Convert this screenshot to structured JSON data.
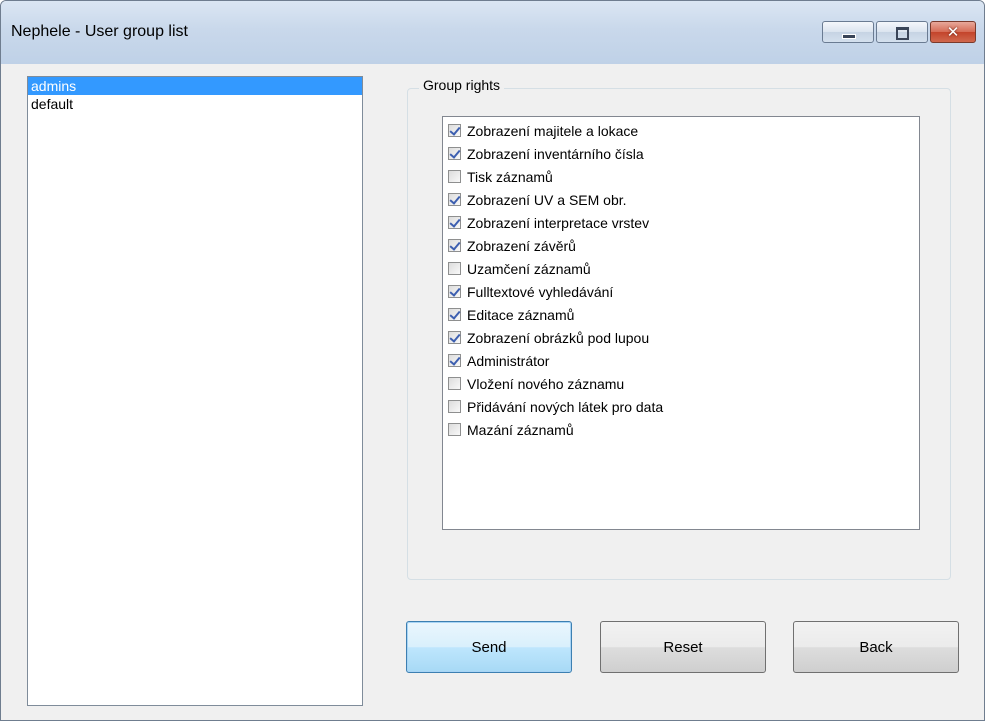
{
  "window": {
    "title": "Nephele - User group list",
    "minimize_label": "",
    "close_glyph": "✕"
  },
  "groups": [
    {
      "label": "admins",
      "selected": true
    },
    {
      "label": "default",
      "selected": false
    }
  ],
  "rights": {
    "legend": "Group rights",
    "items": [
      {
        "label": "Zobrazení majitele a lokace",
        "checked": true
      },
      {
        "label": "Zobrazení inventárního čísla",
        "checked": true
      },
      {
        "label": "Tisk záznamů",
        "checked": false
      },
      {
        "label": "Zobrazení UV a SEM obr.",
        "checked": true
      },
      {
        "label": "Zobrazení interpretace vrstev",
        "checked": true
      },
      {
        "label": "Zobrazení závěrů",
        "checked": true
      },
      {
        "label": "Uzamčení záznamů",
        "checked": false
      },
      {
        "label": "Fulltextové vyhledávání",
        "checked": true
      },
      {
        "label": "Editace záznamů",
        "checked": true
      },
      {
        "label": "Zobrazení obrázků pod lupou",
        "checked": true
      },
      {
        "label": "Administrátor",
        "checked": true
      },
      {
        "label": "Vložení nového záznamu",
        "checked": false
      },
      {
        "label": "Přidávání nových látek pro data",
        "checked": false
      },
      {
        "label": "Mazání záznamů",
        "checked": false
      }
    ]
  },
  "buttons": {
    "send": "Send",
    "reset": "Reset",
    "back": "Back"
  },
  "colors": {
    "selection": "#3399ff",
    "checkmark": "#3d5fb0"
  },
  "icons": {
    "minimize": "minimize-icon",
    "maximize": "maximize-icon",
    "close": "close-icon"
  }
}
